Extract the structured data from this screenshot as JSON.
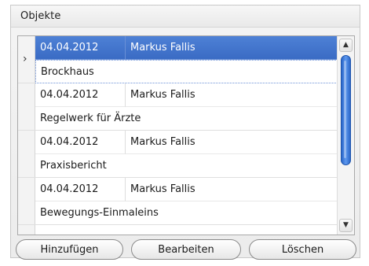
{
  "panel": {
    "title": "Objekte"
  },
  "grid": {
    "selected_index": 0,
    "records": [
      {
        "date": "04.04.2012",
        "user": "Markus Fallis",
        "title": "Brockhaus"
      },
      {
        "date": "04.04.2012",
        "user": "Markus Fallis",
        "title": "Regelwerk für Ärzte"
      },
      {
        "date": "04.04.2012",
        "user": "Markus Fallis",
        "title": "Praxisbericht"
      },
      {
        "date": "04.04.2012",
        "user": "Markus Fallis",
        "title": "Bewegungs-Einmaleins"
      }
    ]
  },
  "icons": {
    "current_row": "chevron-right-icon",
    "scroll_up": "triangle-up-icon",
    "scroll_down": "triangle-down-icon"
  },
  "buttons": {
    "add_label": "Hinzufügen",
    "edit_label": "Bearbeiten",
    "delete_label": "Löschen"
  },
  "colors": {
    "selection": "#3f71c9",
    "scroll_thumb": "#3a77d9"
  }
}
